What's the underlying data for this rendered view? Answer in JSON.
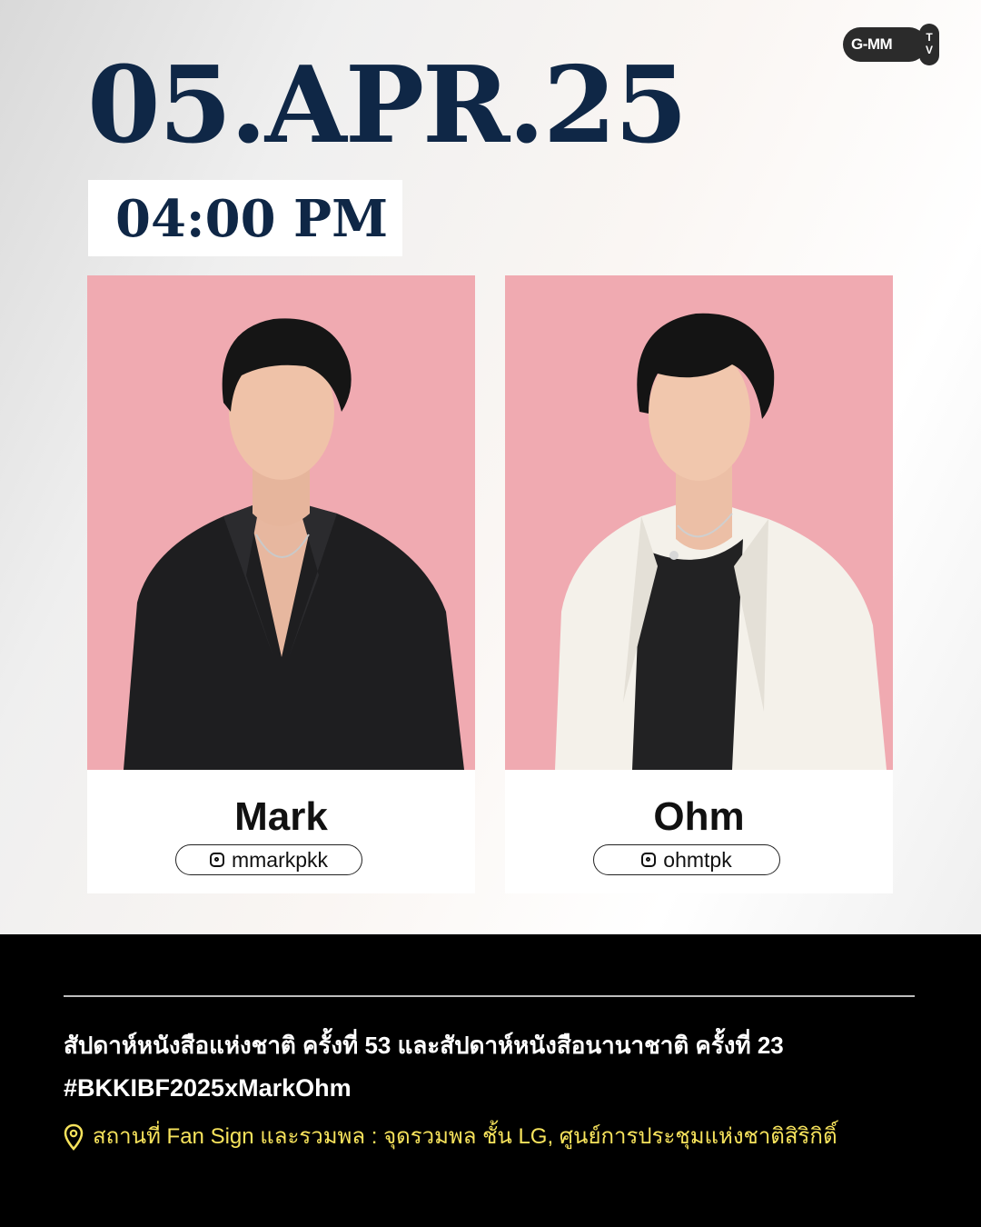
{
  "brand": {
    "logo_text": "G-MM",
    "logo_tv": "TV"
  },
  "event": {
    "date": "05.APR.25",
    "time": "04:00 PM"
  },
  "artists": [
    {
      "name": "Mark",
      "instagram": "mmarkpkk"
    },
    {
      "name": "Ohm",
      "instagram": "ohmtpk"
    }
  ],
  "footer": {
    "event_title": "สัปดาห์หนังสือแห่งชาติ ครั้งที่ 53 และสัปดาห์หนังสือนานาชาติ ครั้งที่ 23",
    "hashtag": "#BKKIBF2025xMarkOhm",
    "venue": "สถานที่ Fan Sign และรวมพล : จุดรวมพล ชั้น LG, ศูนย์การประชุมแห่งชาติสิริกิติ์"
  },
  "colors": {
    "navy": "#0f2746",
    "photo_background": "#f0aab1",
    "footer_background": "#000000",
    "venue_text": "#f7e35c",
    "mark_jacket": "#1e1e20",
    "ohm_jacket": "#f4f1ea"
  }
}
